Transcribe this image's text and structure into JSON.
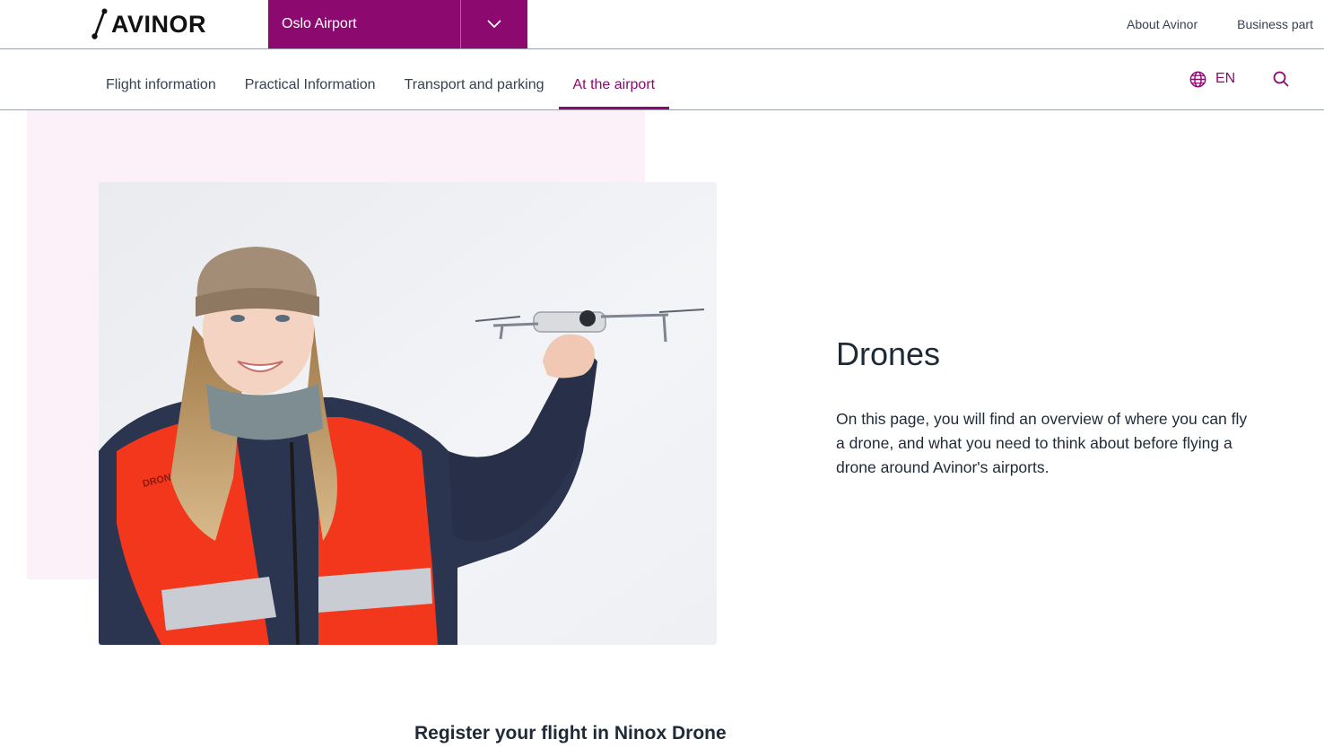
{
  "brand": {
    "logo_text": "AVINOR",
    "accent_color": "#8c0a6f",
    "hero_bg_color": "#fcf1f8"
  },
  "airport_selector": {
    "selected": "Oslo Airport",
    "icon": "chevron-down-icon"
  },
  "top_links": [
    {
      "label": "About Avinor"
    },
    {
      "label": "Business part"
    }
  ],
  "nav": {
    "tabs": [
      {
        "label": "Flight information",
        "active": false
      },
      {
        "label": "Practical Information",
        "active": false
      },
      {
        "label": "Transport and parking",
        "active": false
      },
      {
        "label": "At the airport",
        "active": true
      }
    ],
    "language": {
      "label": "EN",
      "icon": "globe-icon"
    },
    "search": {
      "icon": "search-icon"
    }
  },
  "hero": {
    "image_alt": "Woman in a knit hat and reflective vest holding a small drone",
    "vest_text": "DRONE",
    "title": "Drones",
    "intro": "On this page, you will find an overview of where you can fly a drone, and what you need to think about before flying a drone around Avinor's airports."
  },
  "section": {
    "heading": "Register your flight in Ninox Drone"
  }
}
